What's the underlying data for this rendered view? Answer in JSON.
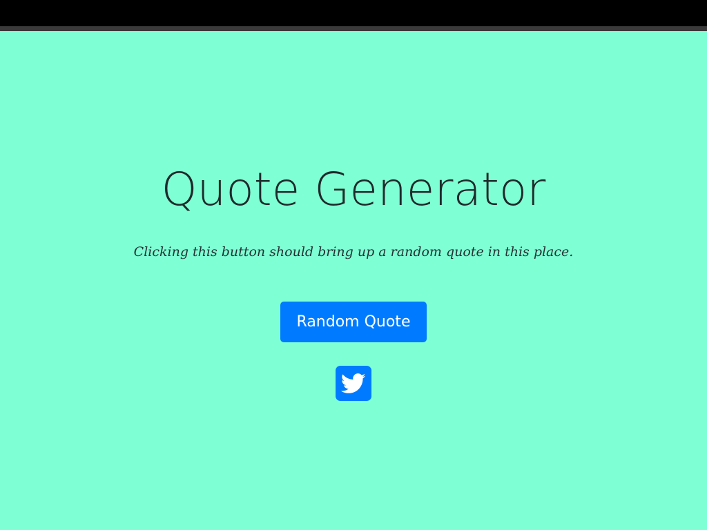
{
  "header": {
    "title": "Quote Generator"
  },
  "quote": {
    "text": "Clicking this button should bring up a random quote in this place."
  },
  "actions": {
    "random_quote_label": "Random Quote",
    "tweet_icon": "twitter-icon"
  },
  "colors": {
    "background": "#7fffd4",
    "accent": "#007bff",
    "topbar": "#000000"
  }
}
